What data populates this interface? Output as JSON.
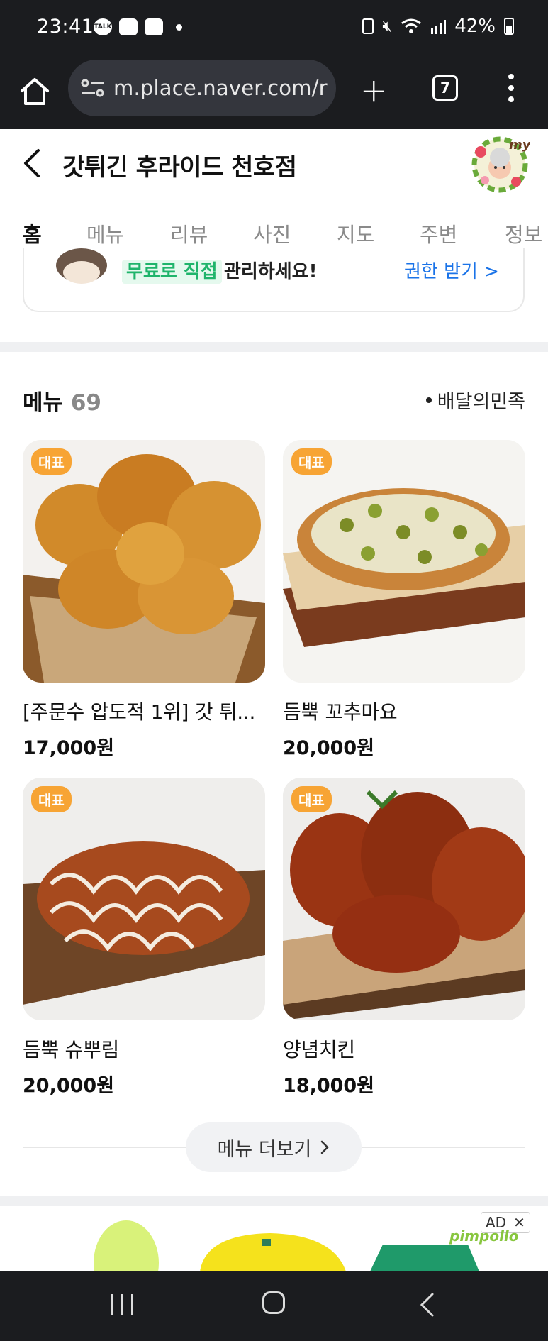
{
  "status_bar": {
    "time": "23:41",
    "notif_icons": [
      "talk-icon",
      "message-icon",
      "gallery-icon"
    ],
    "battery": "42%"
  },
  "browser": {
    "url": "m.place.naver.com/r",
    "tab_count": "7"
  },
  "header": {
    "title": "갓튀긴 후라이드 천호점"
  },
  "tabs": [
    {
      "label": "홈"
    },
    {
      "label": "메뉴"
    },
    {
      "label": "리뷰"
    },
    {
      "label": "사진"
    },
    {
      "label": "지도"
    },
    {
      "label": "주변"
    },
    {
      "label": "정보"
    }
  ],
  "banner": {
    "highlight": "무료로 직접",
    "text": "관리하세요!",
    "cta": "권한 받기 >"
  },
  "menu": {
    "title": "메뉴",
    "count": "69",
    "source": "배달의민족",
    "items": [
      {
        "badge": "대표",
        "name": "[주문수 압도적 1위] 갓 튀...",
        "price": "17,000원"
      },
      {
        "badge": "대표",
        "name": "듬뿍 꼬추마요",
        "price": "20,000원"
      },
      {
        "badge": "대표",
        "name": "듬뿍 슈뿌림",
        "price": "20,000원"
      },
      {
        "badge": "대표",
        "name": "양념치킨",
        "price": "18,000원"
      }
    ],
    "more_label": "메뉴 더보기"
  },
  "ad": {
    "label": "AD",
    "brand": "pimpollo"
  },
  "colors": {
    "accent_badge": "#f7a434",
    "link": "#1a73e8",
    "highlight_green": "#1fb46b"
  }
}
